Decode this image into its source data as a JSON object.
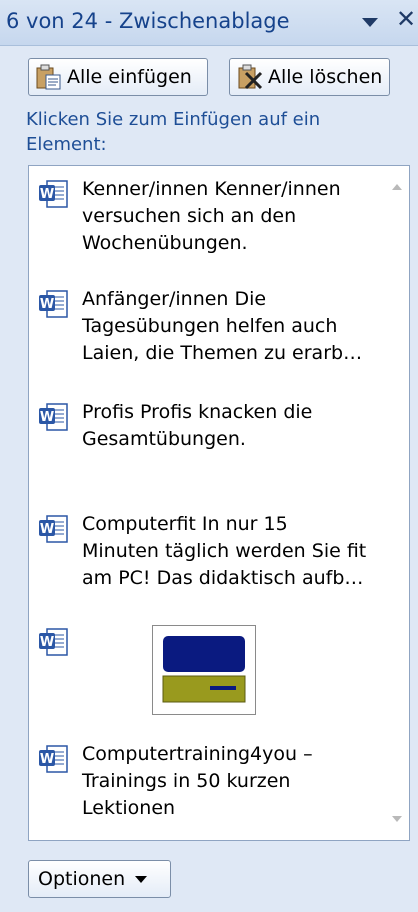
{
  "pane": {
    "title": "6 von 24 - Zwischenablage",
    "close_glyph": "✕",
    "hint": "Klicken Sie zum Einfügen auf ein Element:"
  },
  "toolbar": {
    "paste_all_label": "Alle einfügen",
    "clear_all_label": "Alle löschen"
  },
  "items": [
    {
      "icon": "word-document-icon",
      "text": "Kenner/innen Kenner/innen\nversuchen sich an den\nWochenübungen."
    },
    {
      "icon": "word-document-icon",
      "text": "Anfänger/innen Die\nTagesübungen helfen auch\nLaien, die Themen zu erarb…"
    },
    {
      "icon": "word-document-icon",
      "text": "Profis Profis knacken die\nGesamtübungen."
    },
    {
      "icon": "word-document-icon",
      "text": "Computerfit In nur 15\nMinuten täglich werden Sie fit\nam PC! Das didaktisch aufb…"
    },
    {
      "icon": "word-document-icon",
      "text": ""
    },
    {
      "icon": "word-document-icon",
      "text": "Computertraining4you –\nTrainings in 50 kurzen\nLektionen"
    }
  ],
  "options": {
    "label": "Optionen"
  },
  "colors": {
    "accent": "#15428b",
    "hint": "#1e4e96",
    "thumb_top": "#0a1a80",
    "thumb_bottom": "#999a1e"
  }
}
